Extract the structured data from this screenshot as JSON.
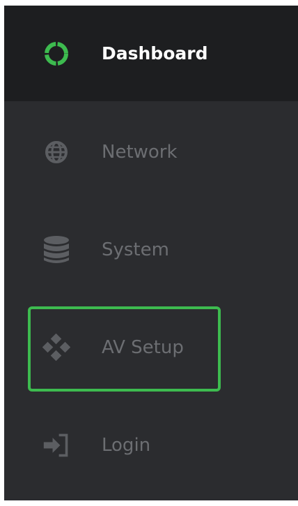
{
  "colors": {
    "sidebar_bg": "#2b2c2f",
    "active_bg": "#1d1e20",
    "active_text": "#ffffff",
    "inactive_text": "#6c6e72",
    "accent": "#3dbb4f"
  },
  "nav": {
    "items": [
      {
        "label": "Dashboard",
        "icon": "dashboard-ring-icon",
        "active": true
      },
      {
        "label": "Network",
        "icon": "globe-icon",
        "active": false
      },
      {
        "label": "System",
        "icon": "database-icon",
        "active": false
      },
      {
        "label": "AV Setup",
        "icon": "diamond-grid-icon",
        "active": false,
        "highlighted": true
      },
      {
        "label": "Login",
        "icon": "sign-in-icon",
        "active": false
      }
    ]
  }
}
